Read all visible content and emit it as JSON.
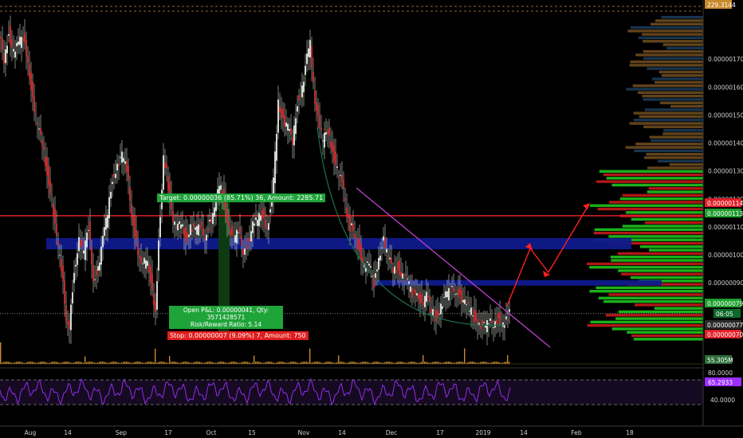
{
  "chart_data": {
    "type": "line",
    "title": "",
    "price_axis": {
      "ticks": [
        "0.00000170",
        "0.00000160",
        "0.00000150",
        "0.00000140",
        "0.00000130",
        "0.00000120",
        "0.00000110",
        "0.00000100",
        "0.00000090"
      ],
      "tick_values": [
        1.7,
        1.6,
        1.5,
        1.4,
        1.3,
        1.2,
        1.1,
        1.0,
        0.9
      ],
      "ylim": [
        0.63,
        1.86
      ],
      "unit_note": "values in 1e-6"
    },
    "time_axis": {
      "ticks": [
        "Aug",
        "14",
        "Sep",
        "17",
        "Oct",
        "15",
        "Nov",
        "14",
        "Dec",
        "17",
        "2019",
        "14",
        "Feb",
        "18"
      ]
    },
    "price_series": {
      "name": "",
      "points": [
        [
          0,
          1.78
        ],
        [
          6,
          1.7
        ],
        [
          12,
          1.8
        ],
        [
          18,
          1.72
        ],
        [
          24,
          1.75
        ],
        [
          30,
          1.78
        ],
        [
          36,
          1.7
        ],
        [
          42,
          1.55
        ],
        [
          48,
          1.45
        ],
        [
          54,
          1.4
        ],
        [
          60,
          1.3
        ],
        [
          66,
          1.2
        ],
        [
          72,
          1.05
        ],
        [
          78,
          0.95
        ],
        [
          84,
          0.78
        ],
        [
          88,
          0.75
        ],
        [
          94,
          0.95
        ],
        [
          100,
          1.05
        ],
        [
          106,
          1.0
        ],
        [
          112,
          1.1
        ],
        [
          118,
          0.92
        ],
        [
          124,
          0.95
        ],
        [
          130,
          1.05
        ],
        [
          136,
          1.15
        ],
        [
          142,
          1.28
        ],
        [
          148,
          1.32
        ],
        [
          154,
          1.35
        ],
        [
          160,
          1.3
        ],
        [
          166,
          1.15
        ],
        [
          172,
          1.05
        ],
        [
          178,
          0.95
        ],
        [
          184,
          0.98
        ],
        [
          190,
          0.92
        ],
        [
          196,
          0.8
        ],
        [
          200,
          1.05
        ],
        [
          206,
          1.35
        ],
        [
          210,
          1.3
        ],
        [
          216,
          1.15
        ],
        [
          222,
          1.08
        ],
        [
          228,
          1.12
        ],
        [
          234,
          1.06
        ],
        [
          240,
          1.1
        ],
        [
          246,
          1.08
        ],
        [
          252,
          1.1
        ],
        [
          258,
          1.07
        ],
        [
          264,
          1.12
        ],
        [
          270,
          1.15
        ],
        [
          276,
          1.25
        ],
        [
          282,
          1.2
        ],
        [
          288,
          1.1
        ],
        [
          294,
          1.05
        ],
        [
          300,
          1.08
        ],
        [
          306,
          1.02
        ],
        [
          312,
          1.05
        ],
        [
          318,
          1.1
        ],
        [
          324,
          1.12
        ],
        [
          330,
          1.15
        ],
        [
          336,
          1.1
        ],
        [
          342,
          1.2
        ],
        [
          346,
          1.35
        ],
        [
          350,
          1.55
        ],
        [
          356,
          1.48
        ],
        [
          362,
          1.45
        ],
        [
          368,
          1.4
        ],
        [
          374,
          1.55
        ],
        [
          380,
          1.6
        ],
        [
          386,
          1.7
        ],
        [
          390,
          1.75
        ],
        [
          394,
          1.6
        ],
        [
          400,
          1.48
        ],
        [
          406,
          1.4
        ],
        [
          412,
          1.45
        ],
        [
          418,
          1.38
        ],
        [
          424,
          1.3
        ],
        [
          430,
          1.25
        ],
        [
          436,
          1.15
        ],
        [
          440,
          1.1
        ],
        [
          446,
          1.08
        ],
        [
          452,
          1.02
        ],
        [
          458,
          0.95
        ],
        [
          464,
          0.96
        ],
        [
          470,
          0.9
        ],
        [
          476,
          1.0
        ],
        [
          482,
          1.05
        ],
        [
          488,
          0.98
        ],
        [
          494,
          0.95
        ],
        [
          500,
          0.96
        ],
        [
          506,
          0.92
        ],
        [
          512,
          0.9
        ],
        [
          518,
          0.86
        ],
        [
          524,
          0.88
        ],
        [
          530,
          0.82
        ],
        [
          536,
          0.85
        ],
        [
          542,
          0.8
        ],
        [
          548,
          0.78
        ],
        [
          554,
          0.82
        ],
        [
          560,
          0.85
        ],
        [
          566,
          0.87
        ],
        [
          572,
          0.88
        ],
        [
          578,
          0.86
        ],
        [
          584,
          0.82
        ],
        [
          590,
          0.8
        ],
        [
          596,
          0.78
        ],
        [
          602,
          0.76
        ],
        [
          608,
          0.74
        ],
        [
          614,
          0.75
        ],
        [
          620,
          0.76
        ],
        [
          626,
          0.78
        ],
        [
          632,
          0.74
        ],
        [
          636,
          0.76
        ],
        [
          640,
          0.8
        ]
      ]
    },
    "horizontal_levels": [
      {
        "label": "0.00000114",
        "value": 1.14,
        "color": "#e0202a"
      },
      {
        "label": "0.00000113",
        "value": 1.13,
        "color": "#1e9e2e"
      }
    ],
    "zones": [
      {
        "name": "blue-zone-upper",
        "from": 1.02,
        "to": 1.06,
        "color": "#0f1a8c"
      },
      {
        "name": "blue-zone-lower",
        "from": 0.89,
        "to": 0.91,
        "color": "#0f1a8c"
      }
    ],
    "price_labels": [
      {
        "text": "229.3144",
        "color": "#c98a2b"
      },
      {
        "text": "0.00000114",
        "color": "#e0202a"
      },
      {
        "text": "0.00000113",
        "color": "#1e9e2e"
      },
      {
        "text": "0.00000079",
        "color": "#1e9e2e"
      },
      {
        "text": "06:05",
        "color": "#0e6a2a"
      },
      {
        "text": "0.00000077",
        "color": "#2a2a2a"
      },
      {
        "text": "0.00000070",
        "color": "#e0202a"
      },
      {
        "text": "55.305M",
        "color": "#2d6e3a"
      }
    ],
    "annotations": {
      "target": "Target: 0.00000036 (85.71%) 36, Amount: 2285.71",
      "open_pnl": "Open P&L: 0.00000041, Qty: 3571428571",
      "risk_reward": "Risk/Reward Ratio: 5.14",
      "stop": "Stop: 0.00000007 (9.09%) 7, Amount: 750"
    },
    "rsi": {
      "ticks": [
        "80.0000",
        "40.0000"
      ],
      "current": "65.2933",
      "upper": 70,
      "lower": 30,
      "color": "#9b30ff"
    }
  },
  "colors": {
    "background": "#000000",
    "up_candle": "#2fa84f",
    "down_candle": "#d23030",
    "trend_line": "#c040d0",
    "arc": "#1d6e4a",
    "projection": "#ff2020",
    "volume": "#c98a2b",
    "profile_green": "#1ec41e",
    "profile_red": "#c41a1a",
    "profile_blue": "#1b3a55",
    "profile_brown": "#6b4a1e"
  }
}
